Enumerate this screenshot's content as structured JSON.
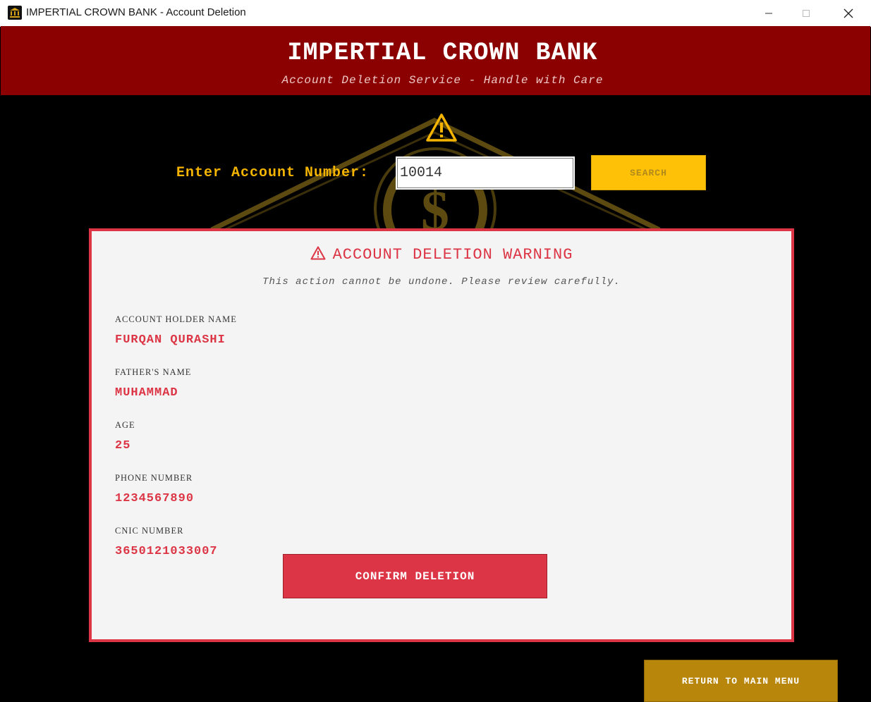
{
  "window": {
    "title": "IMPERTIAL CROWN BANK - Account Deletion",
    "icon": "bank-icon"
  },
  "header": {
    "bank_name": "IMPERTIAL CROWN BANK",
    "subtitle": "Account Deletion Service - Handle with Care"
  },
  "search": {
    "label": "Enter Account Number:",
    "value": "10014",
    "button_label": "SEARCH"
  },
  "warning_panel": {
    "heading": "ACCOUNT DELETION WARNING",
    "note": "This action cannot be undone. Please review carefully.",
    "fields": [
      {
        "label": "ACCOUNT HOLDER NAME",
        "value": "FURQAN QURASHI"
      },
      {
        "label": "FATHER'S NAME",
        "value": "MUHAMMAD"
      },
      {
        "label": "AGE",
        "value": "25"
      },
      {
        "label": "PHONE NUMBER",
        "value": "1234567890"
      },
      {
        "label": "CNIC NUMBER",
        "value": "3650121033007"
      }
    ],
    "confirm_label": "CONFIRM DELETION"
  },
  "footer": {
    "return_label": "RETURN TO MAIN MENU"
  },
  "colors": {
    "header_bg": "#8b0000",
    "accent_gold": "#f4b400",
    "search_button": "#ffc107",
    "danger": "#dc3545",
    "return_button": "#b8860b"
  }
}
